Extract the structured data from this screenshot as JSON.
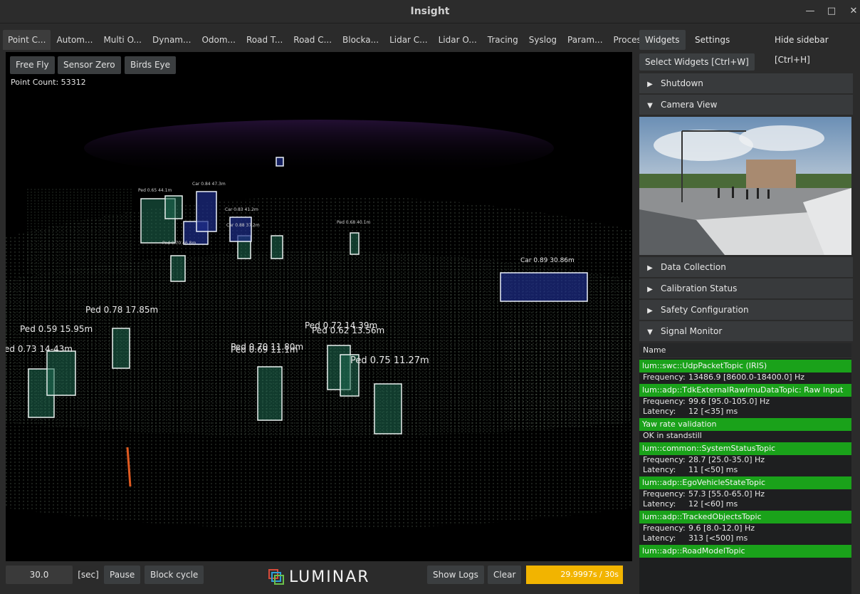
{
  "window": {
    "title": "Insight"
  },
  "tabs": [
    "Point C...",
    "Autom...",
    "Multi O...",
    "Dynam...",
    "Odom...",
    "Road T...",
    "Road C...",
    "Blocka...",
    "Lidar C...",
    "Lidar O...",
    "Tracing",
    "Syslog",
    "Param...",
    "Proces..."
  ],
  "viewport": {
    "buttons": [
      "Free Fly",
      "Sensor Zero",
      "Birds Eye"
    ],
    "point_count": "Point Count: 53312",
    "labels": {
      "car1": "Car 0.89 30.86m",
      "ped1": "Ped 0.78 17.85m",
      "ped2": "Ped 0.59 15.95m",
      "ped3": "ed 0.73 14-43m",
      "ped4": "Ped 0.72 14.39m",
      "ped5": "Ped 0.62 13.56m",
      "ped6": "Ped 0.70 11.80m",
      "ped7": "Ped 0.69 11.1m",
      "ped8": "Ped 0.75 11.27m",
      "ped9": "Ped 0.68 40.1m",
      "car_far1": "Car 0.83 41.2m",
      "car_far2": "Car 0.88 37.2m",
      "far1": "Ped 0.65 44.1m",
      "far2": "Car 0.84 47.3m",
      "far3": "Ped 0.70 46.8m"
    }
  },
  "bottom": {
    "time_value": "30.0",
    "unit": "[sec]",
    "pause": "Pause",
    "block_cycle": "Block cycle",
    "logo": "LUMINAR",
    "show_logs": "Show Logs",
    "clear": "Clear",
    "progress_text": "29.9997s / 30s",
    "progress": 0.99
  },
  "sidebar": {
    "tabs": {
      "widgets": "Widgets",
      "settings": "Settings",
      "hide": "Hide sidebar [Ctrl+H]"
    },
    "select_widgets": "Select Widgets [Ctrl+W]",
    "sections": {
      "shutdown": "Shutdown",
      "camera_view": "Camera View",
      "data_collection": "Data Collection",
      "calibration": "Calibration Status",
      "safety": "Safety Configuration",
      "signal_monitor": "Signal Monitor"
    },
    "signal": {
      "header": "Name",
      "topics": [
        {
          "name": "lum::swc::UdpPacketTopic (IRIS)",
          "rows": [
            [
              "Frequency:",
              "13486.9 [8600.0-18400.0] Hz"
            ]
          ]
        },
        {
          "name": "lum::adp::TdkExternalRawImuDataTopic: Raw Input",
          "rows": [
            [
              "Frequency:",
              "99.6 [95.0-105.0] Hz"
            ],
            [
              "Latency:",
              "12 [<35] ms"
            ]
          ]
        },
        {
          "name": "Yaw rate validation",
          "rows": [
            [
              "OK in standstill",
              ""
            ]
          ]
        },
        {
          "name": "lum::common::SystemStatusTopic",
          "rows": [
            [
              "Frequency:",
              "28.7 [25.0-35.0] Hz"
            ],
            [
              "Latency:",
              "11 [<50] ms"
            ]
          ]
        },
        {
          "name": "lum::adp::EgoVehicleStateTopic",
          "rows": [
            [
              "Frequency:",
              "57.3 [55.0-65.0] Hz"
            ],
            [
              "Latency:",
              "12 [<60] ms"
            ]
          ]
        },
        {
          "name": "lum::adp::TrackedObjectsTopic",
          "rows": [
            [
              "Frequency:",
              "9.6 [8.0-12.0] Hz"
            ],
            [
              "Latency:",
              "313 [<500] ms"
            ]
          ]
        },
        {
          "name": "lum::adp::RoadModelTopic",
          "rows": []
        }
      ]
    }
  },
  "colors": {
    "accent_green": "#1aa21a",
    "progress": "#f2b400"
  }
}
